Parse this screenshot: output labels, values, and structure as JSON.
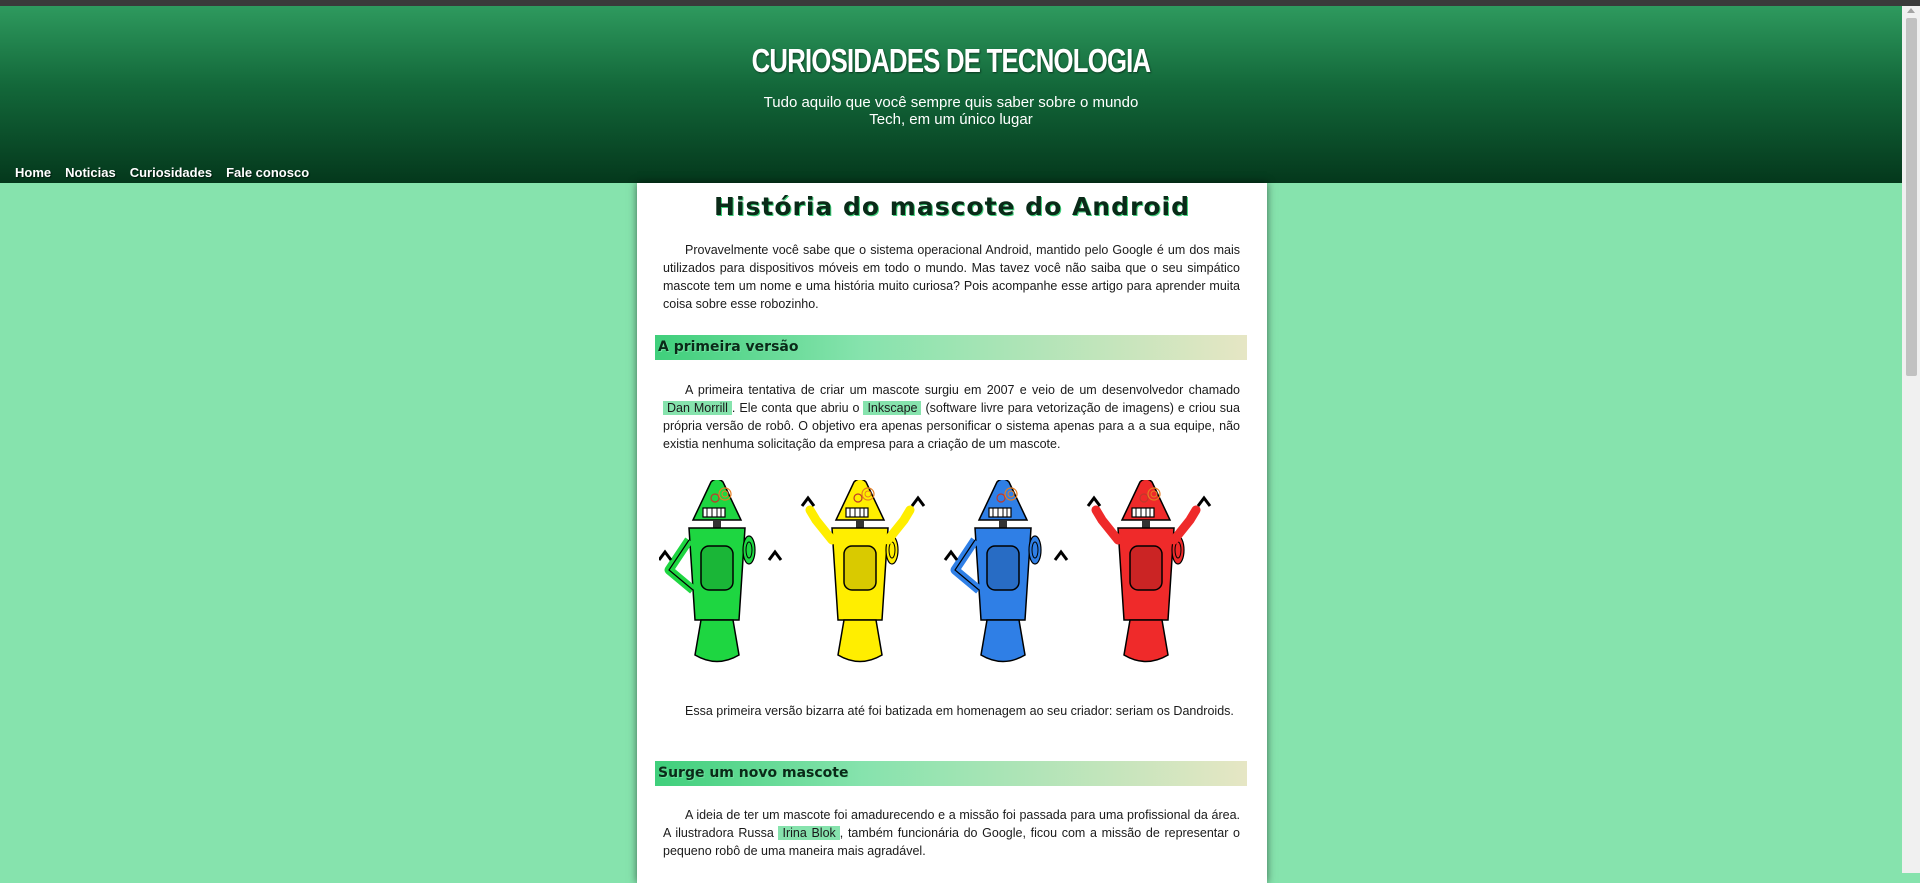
{
  "header": {
    "site_title": "CURIOSIDADES DE TECNOLOGIA",
    "subtitle": "Tudo aquilo que você sempre quis saber sobre o mundo Tech, em um único lugar"
  },
  "nav": {
    "items": [
      {
        "label": "Home"
      },
      {
        "label": "Noticias"
      },
      {
        "label": "Curiosidades"
      },
      {
        "label": "Fale conosco"
      }
    ]
  },
  "article": {
    "title": "História do mascote do Android",
    "intro": "Provavelmente você sabe que o sistema operacional Android, mantido pelo Google é um dos mais utilizados para dispositivos móveis em todo o mundo. Mas tavez você não saiba que o seu simpático mascote tem um nome e uma história muito curiosa? Pois acompanhe esse artigo para aprender muita coisa sobre esse robozinho.",
    "sections": [
      {
        "heading": "A primeira versão",
        "p1_before": "A primeira tentativa de criar um mascote surgiu em 2007 e veio de um desenvolvedor chamado",
        "p1_highlight1": "Dan Morrill",
        "p1_middle": ". Ele conta que abriu o",
        "p1_highlight2": "Inkscape",
        "p1_after": "(software livre para vetorização de imagens) e criou sua própria versão de robô. O objetivo era apenas personificar o sistema apenas para a a sua equipe, não existia nenhuma solicitação da empresa para a criação de um mascote.",
        "p2": "Essa primeira versão bizarra até foi batizada em homenagem ao seu criador: seriam os Dandroids."
      },
      {
        "heading": "Surge um novo mascote",
        "p1_before": "A ideia de ter um mascote foi amadurecendo e a missão foi passada para uma profissional da área. A ilustradora Russa",
        "p1_highlight1": "Irina Blok",
        "p1_after": ", também funcionária do Google, ficou com a missão de representar o pequeno robô de uma maneira mais agradável."
      }
    ],
    "robot_colors": [
      "#1ed641",
      "#ffee00",
      "#2f7fe6",
      "#ef2a2a"
    ]
  },
  "colors": {
    "page_bg": "#86e3ad",
    "header_top": "#2e9a5e",
    "header_bottom": "#04381c",
    "highlight": "#86e3ad"
  }
}
